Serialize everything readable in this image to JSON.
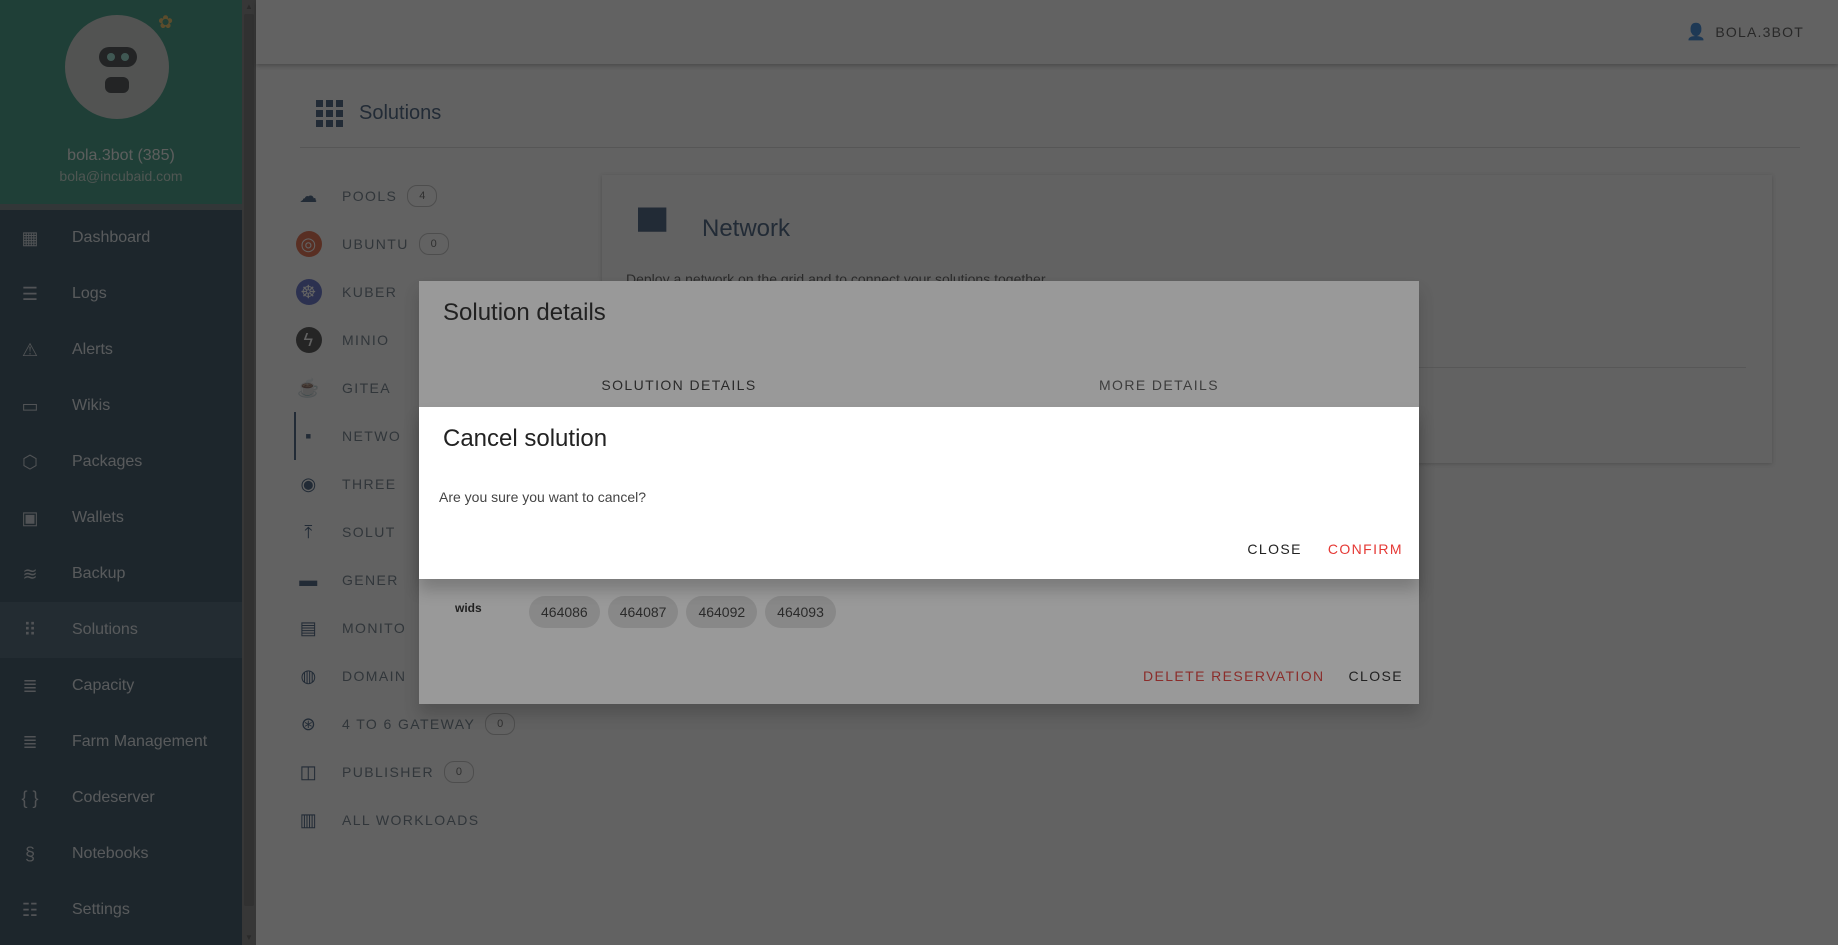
{
  "profile": {
    "name": "bola.3bot (385)",
    "email": "bola@incubaid.com"
  },
  "sidebar": {
    "items": [
      {
        "label": "Dashboard",
        "icon": "dashboard-icon"
      },
      {
        "label": "Logs",
        "icon": "logs-icon"
      },
      {
        "label": "Alerts",
        "icon": "alert-icon"
      },
      {
        "label": "Wikis",
        "icon": "book-icon"
      },
      {
        "label": "Packages",
        "icon": "package-icon"
      },
      {
        "label": "Wallets",
        "icon": "wallet-icon"
      },
      {
        "label": "Backup",
        "icon": "database-icon"
      },
      {
        "label": "Solutions",
        "icon": "apps-grid-icon"
      },
      {
        "label": "Capacity",
        "icon": "server-icon"
      },
      {
        "label": "Farm Management",
        "icon": "server-icon"
      },
      {
        "label": "Codeserver",
        "icon": "code-braces-icon"
      },
      {
        "label": "Notebooks",
        "icon": "python-icon"
      },
      {
        "label": "Settings",
        "icon": "tune-icon"
      }
    ]
  },
  "header": {
    "user": "BOLA.3BOT"
  },
  "page": {
    "title": "Solutions"
  },
  "solutions": [
    {
      "label": "POOLS",
      "count": "4"
    },
    {
      "label": "UBUNTU",
      "count": "0"
    },
    {
      "label": "KUBER"
    },
    {
      "label": "MINIO"
    },
    {
      "label": "GITEA"
    },
    {
      "label": "NETWO"
    },
    {
      "label": "THREE"
    },
    {
      "label": "SOLUT"
    },
    {
      "label": "GENER"
    },
    {
      "label": "MONITO"
    },
    {
      "label": "DOMAIN"
    },
    {
      "label": "4 TO 6 GATEWAY",
      "count": "0"
    },
    {
      "label": "PUBLISHER",
      "count": "0"
    },
    {
      "label": "ALL WORKLOADS"
    }
  ],
  "network_card": {
    "title": "Network",
    "description": "Deploy a network on the grid and to connect your solutions together."
  },
  "solution_dialog": {
    "title": "Solution details",
    "tabs": [
      "SOLUTION DETAILS",
      "MORE DETAILS"
    ],
    "wids_label": "wids",
    "wids": [
      "464086",
      "464087",
      "464092",
      "464093"
    ],
    "delete_label": "DELETE RESERVATION",
    "close_label": "CLOSE"
  },
  "cancel_dialog": {
    "title": "Cancel solution",
    "message": "Are you sure you want to cancel?",
    "close_label": "CLOSE",
    "confirm_label": "CONFIRM"
  },
  "colors": {
    "sidebar_bg": "#17364a",
    "profile_bg": "#1f8a6e",
    "accent": "#27466a",
    "danger": "#e53935"
  }
}
